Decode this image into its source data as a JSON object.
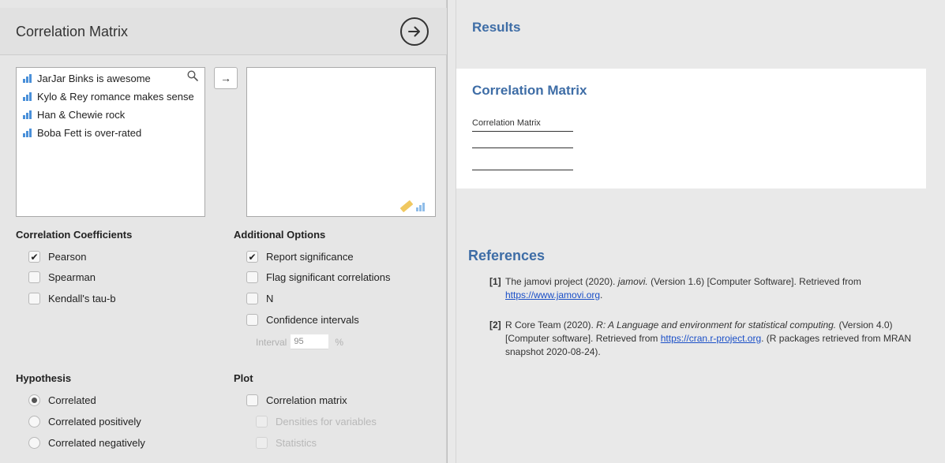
{
  "analysis": {
    "title": "Correlation Matrix"
  },
  "variables": {
    "source": [
      "JarJar Binks is awesome",
      "Kylo & Rey romance makes sense",
      "Han & Chewie rock",
      "Boba Fett is over-rated"
    ],
    "move_label": "→"
  },
  "correlation_coefficients": {
    "title": "Correlation Coefficients",
    "pearson": "Pearson",
    "spearman": "Spearman",
    "kendall": "Kendall's tau-b",
    "checked": {
      "pearson": true,
      "spearman": false,
      "kendall": false
    }
  },
  "additional_options": {
    "title": "Additional Options",
    "report_significance": "Report significance",
    "flag_significant": "Flag significant correlations",
    "n": "N",
    "confidence_intervals": "Confidence intervals",
    "interval_label": "Interval",
    "interval_value": "95",
    "interval_unit": "%",
    "checked": {
      "report_significance": true,
      "flag_significant": false,
      "n": false,
      "confidence_intervals": false
    }
  },
  "hypothesis": {
    "title": "Hypothesis",
    "options": [
      "Correlated",
      "Correlated positively",
      "Correlated negatively"
    ],
    "selected": "Correlated"
  },
  "plot": {
    "title": "Plot",
    "correlation_matrix": "Correlation matrix",
    "densities": "Densities for variables",
    "statistics": "Statistics"
  },
  "results": {
    "heading": "Results",
    "result_title": "Correlation Matrix",
    "table_caption": "Correlation Matrix",
    "references_heading": "References",
    "references": [
      {
        "num": "[1]",
        "pre": "The jamovi project (2020). ",
        "italic": "jamovi.",
        "post": " (Version 1.6) [Computer Software]. Retrieved from ",
        "link": "https://www.jamovi.org",
        "tail": "."
      },
      {
        "num": "[2]",
        "pre": "R Core Team (2020). ",
        "italic": "R: A Language and environment for statistical computing.",
        "post": " (Version 4.0) [Computer software]. Retrieved from ",
        "link": "https://cran.r-project.org",
        "tail": ". (R packages retrieved from MRAN snapshot 2020-08-24)."
      }
    ]
  },
  "colors": {
    "heading_blue": "#3e6da6",
    "link_blue": "#1a4fc7",
    "variable_icon": "#4a90d9"
  }
}
